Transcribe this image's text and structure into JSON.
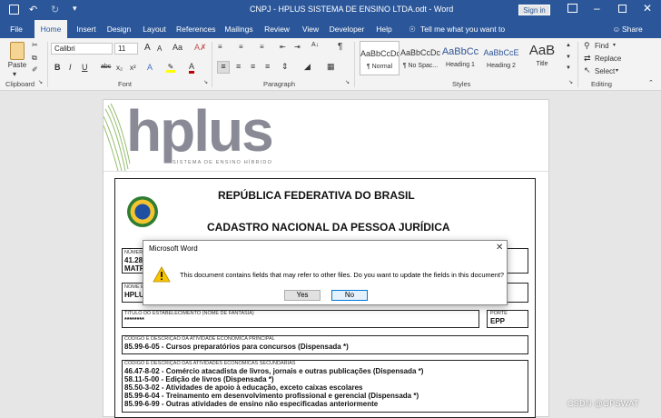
{
  "window": {
    "title": "CNPJ - HPLUS SISTEMA DE ENSINO LTDA.odt - Word",
    "sign_in": "Sign in"
  },
  "tabs": [
    "File",
    "Home",
    "Insert",
    "Design",
    "Layout",
    "References",
    "Mailings",
    "Review",
    "View",
    "Developer",
    "Help"
  ],
  "tell_me": "Tell me what you want to do",
  "share": "Share",
  "clipboard": {
    "paste": "Paste",
    "group": "Clipboard"
  },
  "font": {
    "name": "Calibri",
    "size": "11",
    "group": "Font",
    "grow": "A",
    "shrink": "A",
    "aa": "Aa"
  },
  "format_buttons": [
    "B",
    "I",
    "U",
    "abc",
    "x₂",
    "x²",
    "A",
    "A"
  ],
  "paragraph": {
    "group": "Paragraph"
  },
  "styles": {
    "group": "Styles",
    "items": [
      {
        "preview": "AaBbCcDc",
        "name": "¶ Normal"
      },
      {
        "preview": "AaBbCcDc",
        "name": "¶ No Spac..."
      },
      {
        "preview": "AaBbCc",
        "name": "Heading 1"
      },
      {
        "preview": "AaBbCcE",
        "name": "Heading 2"
      },
      {
        "preview": "AaB",
        "name": "Title"
      }
    ]
  },
  "editing": {
    "group": "Editing",
    "find": "Find",
    "replace": "Replace",
    "select": "Select"
  },
  "colors": {
    "word_blue": "#2b579a",
    "text_highlight": "#ffff00",
    "font_color": "#c00000",
    "hplus_gray": "#8a8a96",
    "hplus_green": "#7cae4a"
  },
  "doc": {
    "logo_text": "hplus",
    "logo_sub": "SISTEMA DE ENSINO HÍBRIDO",
    "heading1": "REPÚBLICA FEDERATIVA DO BRASIL",
    "heading2": "CADASTRO NACIONAL DA PESSOA JURÍDICA",
    "numero_label": "NÚMERO",
    "numero_value": "41.28",
    "matriz": "MATR",
    "nome_label": "NOME E",
    "nome_value": "HPLU",
    "titulo_label": "TÍTULO DO ESTABELECIMENTO (NOME DE FANTASIA)",
    "titulo_value": "********",
    "porte_label": "PORTE",
    "porte_value": "EPP",
    "atividade_principal_label": "CÓDIGO E DESCRIÇÃO DA ATIVIDADE ECONÔMICA PRINCIPAL",
    "atividade_principal_value": "85.99-6-05 - Cursos preparatórios para concursos (Dispensada *)",
    "atividades_secundarias_label": "CÓDIGO E DESCRIÇÃO DAS ATIVIDADES ECONÔMICAS SECUNDÁRIAS",
    "atividades_secundarias": [
      "46.47-8-02 - Comércio atacadista de livros, jornais e outras publicações (Dispensada *)",
      "58.11-5-00 - Edição de livros (Dispensada *)",
      "85.50-3-02 - Atividades de apoio à educação, exceto caixas escolares",
      "85.99-6-04 - Treinamento em desenvolvimento profissional e gerencial (Dispensada *)",
      "85.99-6-99 - Outras atividades de ensino não especificadas anteriormente"
    ]
  },
  "dialog": {
    "title": "Microsoft Word",
    "message": "This document contains fields that may refer to other files. Do you want to update the fields in this document?",
    "yes": "Yes",
    "no": "No"
  },
  "watermark": "CSDN @OPSWAT"
}
